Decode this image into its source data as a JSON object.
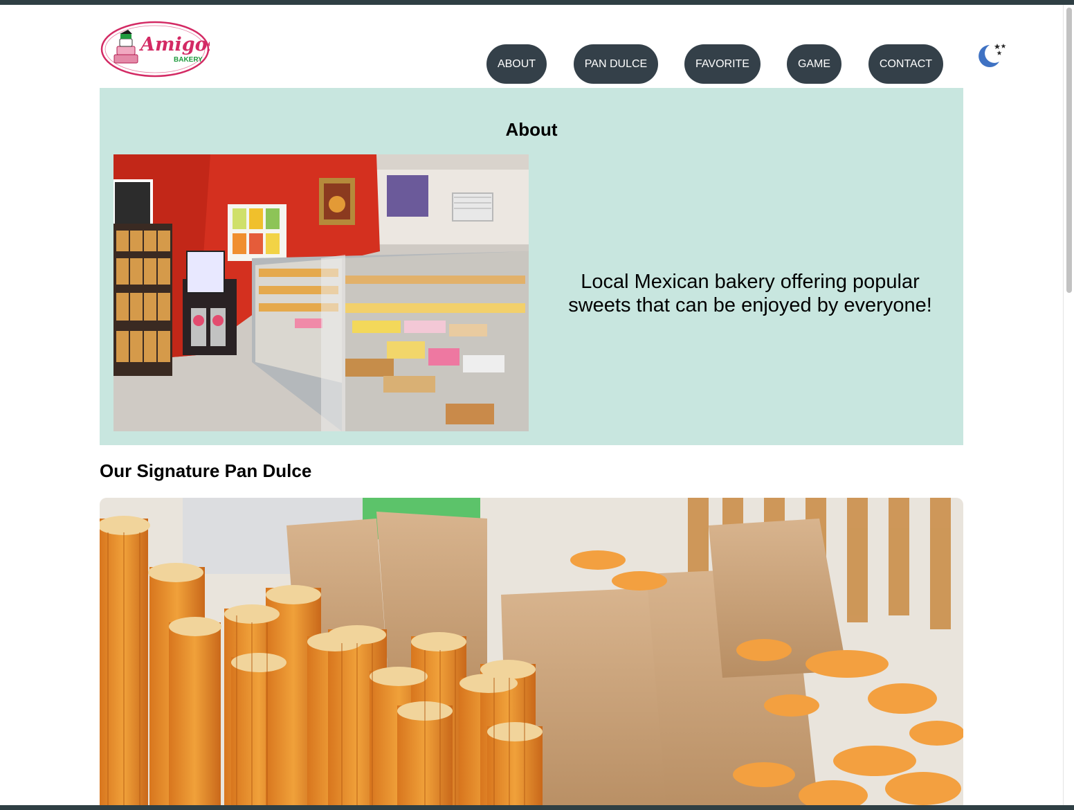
{
  "brand": {
    "logo_word": "Amigos",
    "logo_sub": "BAKERY",
    "colors": {
      "logo_pink": "#d32a64",
      "logo_green": "#1f9b3e",
      "nav_bg": "#344049",
      "nav_text": "#ffffff",
      "about_bg": "#c8e6df",
      "moon": "#3f72c3"
    }
  },
  "nav": {
    "about": "ABOUT",
    "pan_dulce": "PAN DULCE",
    "favorite": "FAVORITE",
    "game": "GAME",
    "contact": "CONTACT"
  },
  "theme_toggle": {
    "icon": "moon-stars-icon"
  },
  "about": {
    "title": "About",
    "text": "Local Mexican bakery offering popular sweets that can be enjoyed by everyone!",
    "image": "bakery-storefront-photo"
  },
  "signature": {
    "title": "Our Signature Pan Dulce",
    "image": "churros-photo"
  }
}
